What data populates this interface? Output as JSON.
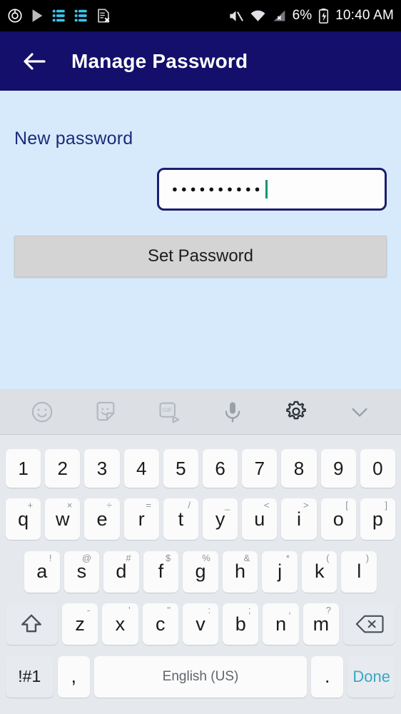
{
  "status_bar": {
    "left_icons": [
      {
        "name": "alarm-clock-icon",
        "glyph": "◎"
      },
      {
        "name": "play-store-icon",
        "glyph": "▷"
      },
      {
        "name": "task-list-icon-1",
        "glyph": "≡"
      },
      {
        "name": "task-list-icon-2",
        "glyph": "≡"
      },
      {
        "name": "document-error-icon",
        "glyph": "⌧"
      }
    ],
    "mute_icon": "volume-muted-icon",
    "wifi_icon": "wifi-icon",
    "signal_icon": "signal-no-service-icon",
    "battery_percent": "6%",
    "battery_icon": "battery-charging-icon",
    "clock": "10:40 AM"
  },
  "appbar": {
    "back_icon": "back-arrow-icon",
    "title": "Manage Password",
    "background": "#130f6b"
  },
  "content": {
    "background": "#d6eafc",
    "field_label": "New password",
    "password_field": {
      "name": "new-password-input",
      "value_masked": "●●●●●●●●●●",
      "character_count": 10,
      "placeholder": "",
      "caret_color": "#0f9675",
      "border_color": "#1b1f6e"
    },
    "set_button_label": "Set Password"
  },
  "keyboard": {
    "toolbar": [
      {
        "name": "emoji-icon",
        "label": "emoji"
      },
      {
        "name": "sticker-icon",
        "label": "sticker"
      },
      {
        "name": "gif-icon",
        "label": "GIF"
      },
      {
        "name": "microphone-icon",
        "label": "voice input"
      },
      {
        "name": "gear-icon",
        "label": "settings"
      },
      {
        "name": "chevron-down-icon",
        "label": "hide keyboard"
      }
    ],
    "row_numbers": [
      {
        "main": "1",
        "sup": ""
      },
      {
        "main": "2",
        "sup": ""
      },
      {
        "main": "3",
        "sup": ""
      },
      {
        "main": "4",
        "sup": ""
      },
      {
        "main": "5",
        "sup": ""
      },
      {
        "main": "6",
        "sup": ""
      },
      {
        "main": "7",
        "sup": ""
      },
      {
        "main": "8",
        "sup": ""
      },
      {
        "main": "9",
        "sup": ""
      },
      {
        "main": "0",
        "sup": ""
      }
    ],
    "row_top": [
      {
        "main": "q",
        "sup": "+"
      },
      {
        "main": "w",
        "sup": "×"
      },
      {
        "main": "e",
        "sup": "÷"
      },
      {
        "main": "r",
        "sup": "="
      },
      {
        "main": "t",
        "sup": "/"
      },
      {
        "main": "y",
        "sup": "_"
      },
      {
        "main": "u",
        "sup": "<"
      },
      {
        "main": "i",
        "sup": ">"
      },
      {
        "main": "o",
        "sup": "["
      },
      {
        "main": "p",
        "sup": "]"
      }
    ],
    "row_home": [
      {
        "main": "a",
        "sup": "!"
      },
      {
        "main": "s",
        "sup": "@"
      },
      {
        "main": "d",
        "sup": "#"
      },
      {
        "main": "f",
        "sup": "$"
      },
      {
        "main": "g",
        "sup": "%"
      },
      {
        "main": "h",
        "sup": "&"
      },
      {
        "main": "j",
        "sup": "*"
      },
      {
        "main": "k",
        "sup": "("
      },
      {
        "main": "l",
        "sup": ")"
      }
    ],
    "row_bottom": [
      {
        "main": "z",
        "sup": "-"
      },
      {
        "main": "x",
        "sup": "'"
      },
      {
        "main": "c",
        "sup": "\""
      },
      {
        "main": "v",
        "sup": ":"
      },
      {
        "main": "b",
        "sup": ";"
      },
      {
        "main": "n",
        "sup": ","
      },
      {
        "main": "m",
        "sup": "?"
      }
    ],
    "shift_key": "shift-key",
    "backspace_key": "backspace-key",
    "row_last": {
      "symbols_label": "!#1",
      "comma_label": ",",
      "space_label": "English (US)",
      "period_label": ".",
      "done_label": "Done",
      "done_color": "#3aa7c4"
    }
  }
}
